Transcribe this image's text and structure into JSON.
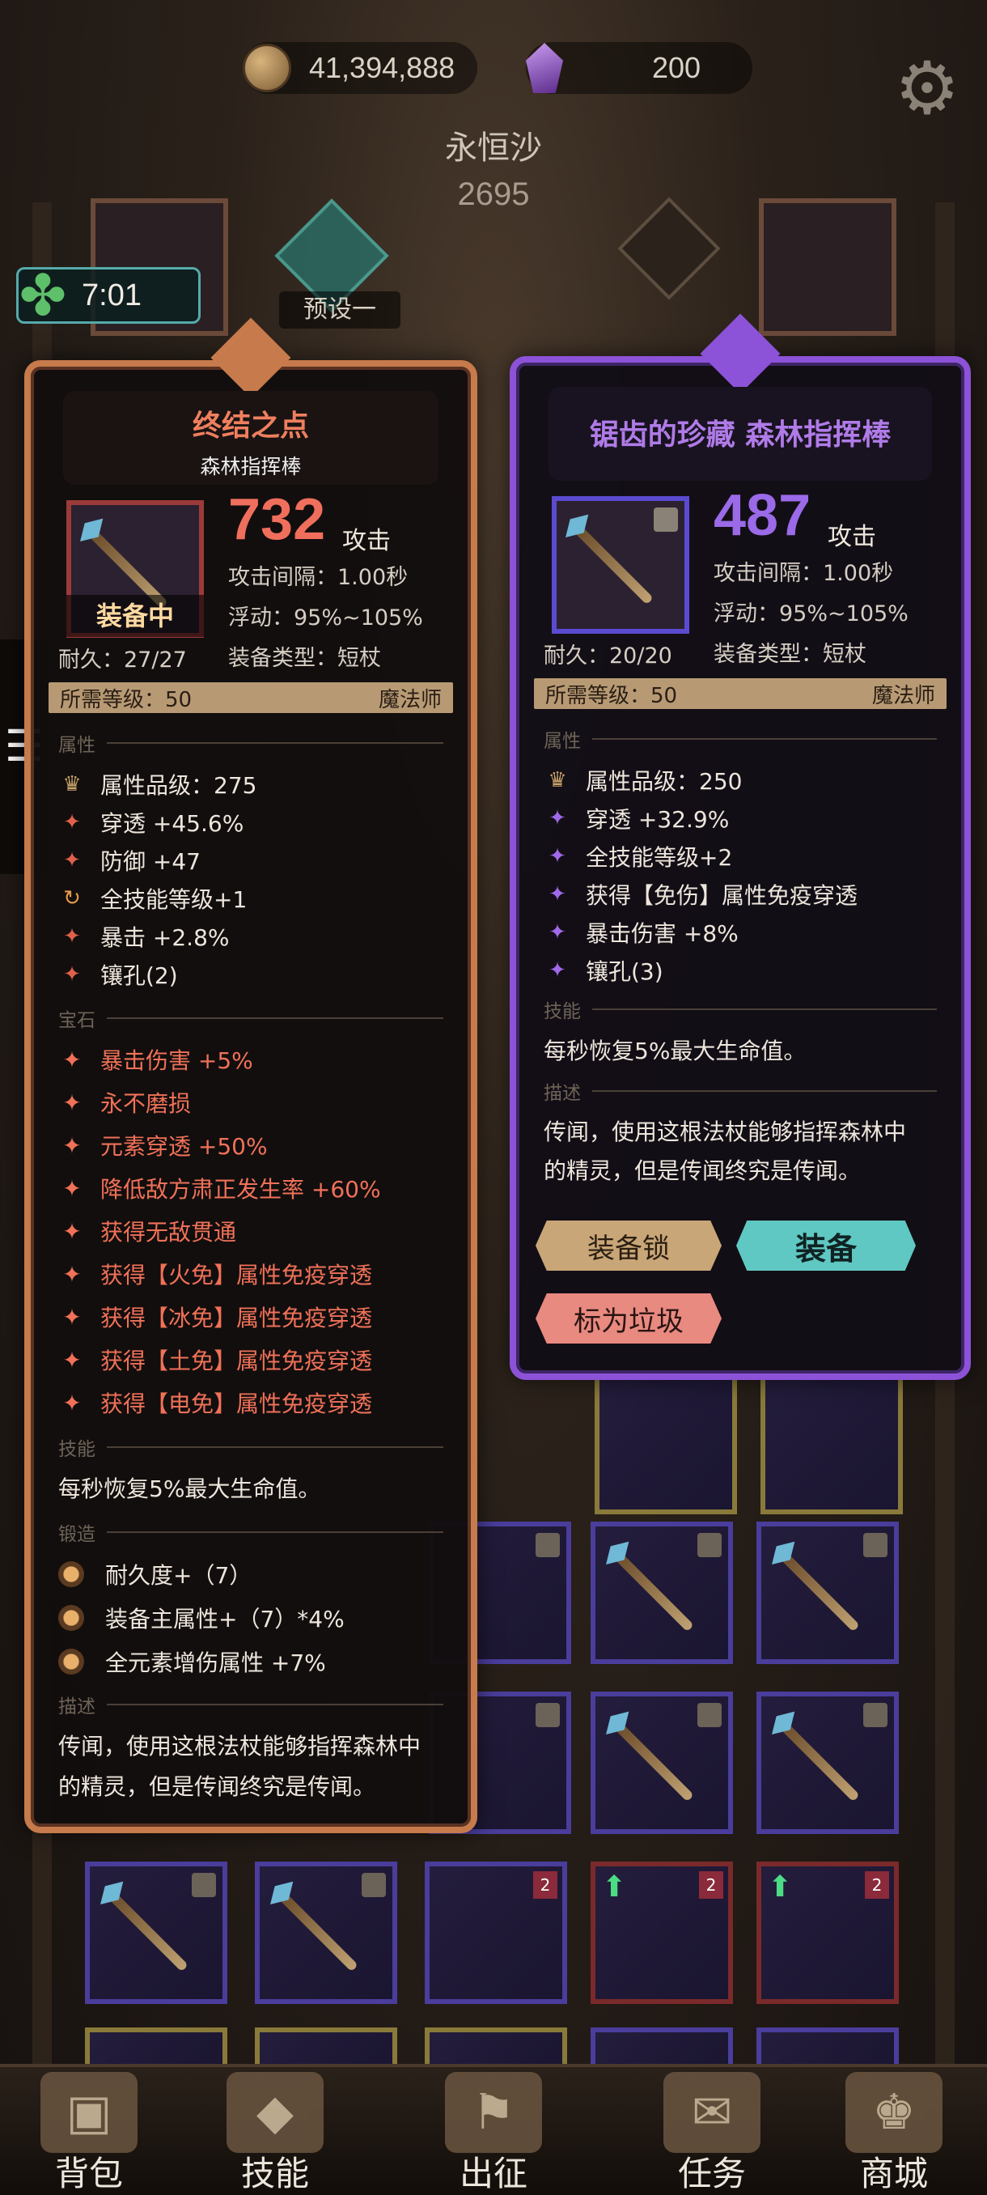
{
  "header": {
    "gold": "41,394,888",
    "gems": "200",
    "map_name": "永恒沙",
    "map_power": "2695",
    "timer": "7:01",
    "preset_label": "预设一"
  },
  "left_card": {
    "title": "终结之点",
    "subtitle": "森林指挥棒",
    "attack_value": "732",
    "attack_label": "攻击",
    "attack_interval": "攻击间隔：1.00秒",
    "variance": "浮动：95%~105%",
    "equip_type": "装备类型：短杖",
    "equipped_label": "装备中",
    "durability": "耐久：27/27",
    "req_level": "所需等级：50",
    "req_class": "魔法师",
    "attributes_header": "属性",
    "attributes": [
      {
        "icon": "quality-icon",
        "text": "属性品级：275"
      },
      {
        "icon": "star-icon",
        "text": "穿透 +45.6%"
      },
      {
        "icon": "star-icon",
        "text": "防御 +47"
      },
      {
        "icon": "cycle-icon",
        "text": "全技能等级+1"
      },
      {
        "icon": "star-icon",
        "text": "暴击 +2.8%"
      },
      {
        "icon": "star-icon",
        "text": "镶孔(2)"
      }
    ],
    "gems_header": "宝石",
    "gems": [
      "暴击伤害 +5%",
      "永不磨损",
      "元素穿透 +50%",
      "降低敌方肃正发生率 +60%",
      "获得无敌贯通",
      "获得【火免】属性免疫穿透",
      "获得【冰免】属性免疫穿透",
      "获得【土免】属性免疫穿透",
      "获得【电免】属性免疫穿透"
    ],
    "skills_header": "技能",
    "skill_text": "每秒恢复5%最大生命值。",
    "forge_header": "锻造",
    "forge": [
      "耐久度+（7）",
      "装备主属性+（7）*4%",
      "全元素增伤属性 +7%"
    ],
    "desc_header": "描述",
    "description_line1": "传闻，使用这根法杖能够指挥森林中",
    "description_line2": "的精灵，但是传闻终究是传闻。"
  },
  "right_card": {
    "title": "锯齿的珍藏 森林指挥棒",
    "attack_value": "487",
    "attack_label": "攻击",
    "attack_interval": "攻击间隔：1.00秒",
    "variance": "浮动：95%~105%",
    "equip_type": "装备类型：短杖",
    "durability": "耐久：20/20",
    "req_level": "所需等级：50",
    "req_class": "魔法师",
    "attributes_header": "属性",
    "attributes": [
      {
        "icon": "quality-icon",
        "text": "属性品级：250"
      },
      {
        "icon": "star-icon",
        "text": "穿透 +32.9%"
      },
      {
        "icon": "star-icon",
        "text": "全技能等级+2"
      },
      {
        "icon": "star-icon",
        "text": "获得【免伤】属性免疫穿透"
      },
      {
        "icon": "star-icon",
        "text": "暴击伤害 +8%"
      },
      {
        "icon": "star-icon",
        "text": "镶孔(3)"
      }
    ],
    "skills_header": "技能",
    "skill_text": "每秒恢复5%最大生命值。",
    "desc_header": "描述",
    "description_line1": "传闻，使用这根法杖能够指挥森林中",
    "description_line2": "的精灵，但是传闻终究是传闻。",
    "lock_button": "装备锁",
    "equip_button": "装备",
    "trash_button": "标为垃圾"
  },
  "bottom_nav": [
    {
      "label": "背包",
      "icon": "backpack-icon"
    },
    {
      "label": "技能",
      "icon": "skill-book-icon"
    },
    {
      "label": "出征",
      "icon": "expedition-icon"
    },
    {
      "label": "任务",
      "icon": "quest-scroll-icon"
    },
    {
      "label": "商城",
      "icon": "shop-icon"
    }
  ],
  "colors": {
    "left_accent": "#c77a4b",
    "right_accent": "#8c52d8",
    "equip_button": "#5fc8c2",
    "gem_text": "#f07158"
  }
}
